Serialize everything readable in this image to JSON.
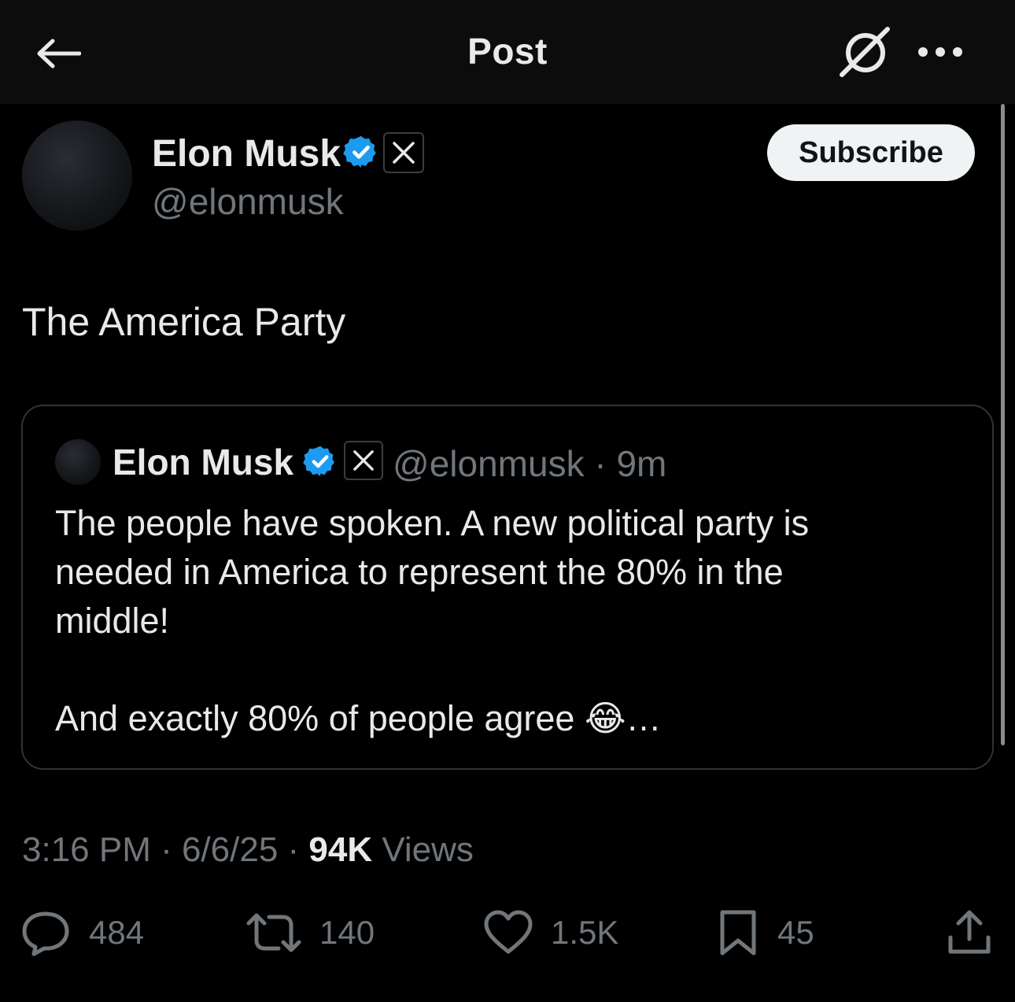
{
  "header": {
    "title": "Post",
    "back_icon": "arrow-left-icon",
    "grok_icon": "grok-icon",
    "more_icon": "more-horizontal-icon"
  },
  "author": {
    "name": "Elon Musk",
    "handle": "@elonmusk",
    "verified_color": "#1d9bf0",
    "subscribe_label": "Subscribe"
  },
  "post": {
    "text": "The America Party"
  },
  "quote": {
    "name": "Elon Musk",
    "handle_time": "@elonmusk · 9m",
    "line1": "The people have spoken. A new political party is",
    "line2": "needed in America to represent the 80% in the",
    "line3": "middle!",
    "line4": "And exactly 80% of people agree 😂…"
  },
  "meta": {
    "time_date": "3:16 PM · 6/6/25 · ",
    "views_count": "94K",
    "views_label": " Views"
  },
  "actions": {
    "replies": "484",
    "reposts": "140",
    "likes": "1.5K",
    "bookmarks": "45"
  }
}
